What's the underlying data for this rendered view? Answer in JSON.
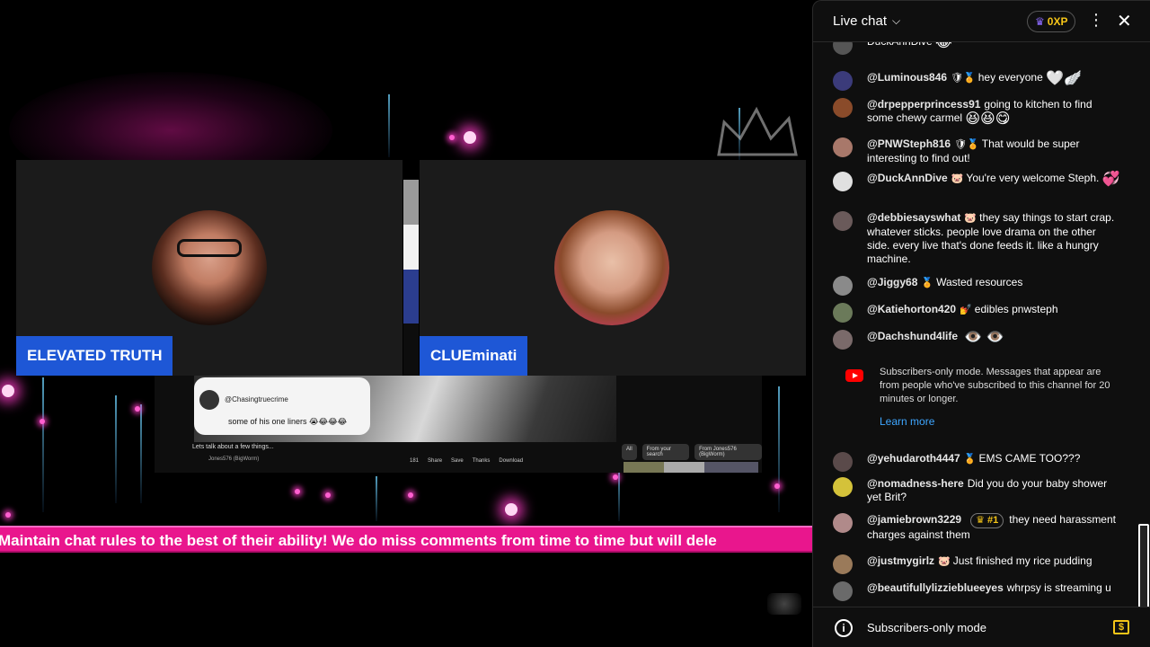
{
  "stage": {
    "participants": [
      {
        "name": "ELEVATED TRUTH"
      },
      {
        "name": "CLUEminati"
      }
    ],
    "shared_screen": {
      "comment_handle": "@Chasingtruecrime",
      "comment_text": "some of his one liners 😭😂😂😂",
      "video_title": "Lets talk about a few things...",
      "channel": "Jones576 (BigWorm)",
      "actions": [
        "181",
        "Share",
        "Save",
        "Thanks",
        "Download"
      ],
      "filters": [
        "All",
        "From your search",
        "From Jones576 (BigWorm)"
      ]
    },
    "ticker": "Maintain chat rules to the best of their ability! We do miss comments from time to time but will dele"
  },
  "chat": {
    "title": "Live chat",
    "xp": "0XP",
    "messages": [
      {
        "author": "",
        "text": "DuckAnnDive",
        "emoji": "😂",
        "avatar_color": "#555555",
        "badges": "",
        "rank": ""
      },
      {
        "author": "@Luminous846",
        "badges": "🛡🏅",
        "text": "hey everyone",
        "emoji": "🤍🪽",
        "avatar_color": "#3b3b7a",
        "rank": ""
      },
      {
        "author": "@drpepperprincess91",
        "badges": "",
        "text": "going to kitchen to find some chewy carmel",
        "emoji": "😆😆😋",
        "avatar_color": "#8a4b2a",
        "rank": ""
      },
      {
        "author": "@PNWSteph816",
        "badges": "🛡🏅",
        "text": "That would be super interesting to find out!",
        "emoji": "",
        "avatar_color": "#a8786a",
        "rank": ""
      },
      {
        "author": "@DuckAnnDive",
        "badges": "🐷",
        "text": "You're very welcome Steph.",
        "emoji": "💞",
        "avatar_color": "#e0e0e0",
        "rank": ""
      },
      {
        "author": "@debbiesayswhat",
        "badges": "🐷",
        "text": "they say things to start crap. whatever sticks. people love drama on the other side. every live that's done feeds it. like a hungry machine.",
        "emoji": "",
        "avatar_color": "#6a5a5a",
        "rank": ""
      },
      {
        "author": "@Jiggy68",
        "badges": "🏅",
        "text": "Wasted resources",
        "emoji": "",
        "avatar_color": "#8a8a8a",
        "rank": ""
      },
      {
        "author": "@Katiehorton420",
        "badges": "💅",
        "text": "edibles pnwsteph",
        "emoji": "",
        "avatar_color": "#6b7a5a",
        "rank": ""
      },
      {
        "author": "@Dachshund4life",
        "badges": "",
        "text": "",
        "emoji": "👁️ 👁️",
        "avatar_color": "#7a6a6a",
        "rank": ""
      },
      {
        "author": "@yehudaroth4447",
        "badges": "🏅",
        "text": "EMS CAME TOO???",
        "emoji": "",
        "avatar_color": "#5a4a4a",
        "rank": ""
      },
      {
        "author": "@nomadness-here",
        "badges": "",
        "text": "Did you do your baby shower yet Brit?",
        "emoji": "",
        "avatar_color": "#d4c23a",
        "rank": ""
      },
      {
        "author": "@jamiebrown3229",
        "badges": "",
        "text": "they need harassment charges against them",
        "emoji": "",
        "avatar_color": "#b08a8a",
        "rank": "#1"
      },
      {
        "author": "@justmygirlz",
        "badges": "🐷",
        "text": "Just finished my rice pudding",
        "emoji": "",
        "avatar_color": "#9a7a5a",
        "rank": ""
      },
      {
        "author": "@beautifullylizzieblueeyes",
        "badges": "",
        "text": "whrpsy is streaming u",
        "emoji": "",
        "avatar_color": "#6a6a6a",
        "rank": ""
      }
    ],
    "notice": {
      "text": "Subscribers-only mode. Messages that appear are from people who've subscribed to this channel for 20 minutes or longer.",
      "link": "Learn more"
    },
    "footer": "Subscribers-only mode"
  }
}
